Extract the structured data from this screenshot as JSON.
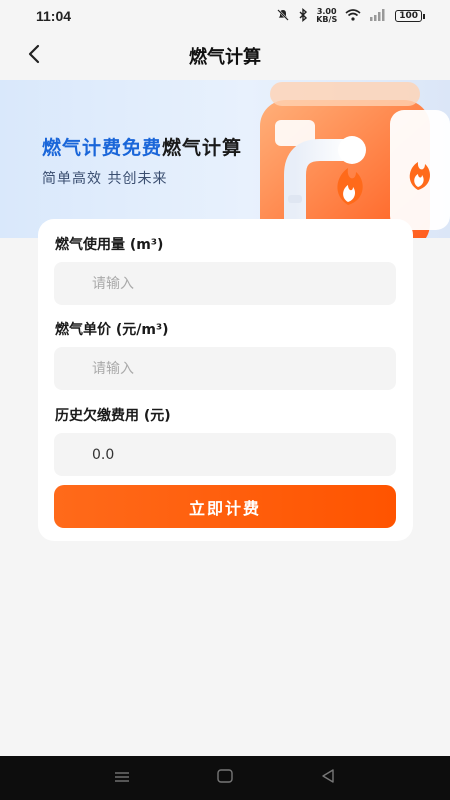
{
  "status_bar": {
    "time": "11:04",
    "speed_value": "3.00",
    "speed_unit": "KB/S",
    "battery": "100",
    "icons": [
      "mute-icon",
      "bluetooth-icon",
      "wifi-icon",
      "signal-icon"
    ]
  },
  "header": {
    "title": "燃气计算",
    "back_icon": "chevron-left-icon"
  },
  "banner": {
    "title_highlight": "燃气计费免费",
    "title_rest": "燃气计算",
    "subtitle": "简单高效 共创未来",
    "accent_color": "#1a66d9"
  },
  "form": {
    "fields": [
      {
        "label": "燃气使用量 (m³)",
        "placeholder": "请输入",
        "value": ""
      },
      {
        "label": "燃气单价 (元/m³)",
        "placeholder": "请输入",
        "value": ""
      },
      {
        "label": "历史欠缴费用 (元)",
        "placeholder": "",
        "value": "0.0"
      }
    ],
    "submit_label": "立即计费",
    "submit_color": "#ff5c0a"
  },
  "system_nav": {
    "icons": [
      "menu-icon",
      "home-icon",
      "back-triangle-icon"
    ]
  }
}
